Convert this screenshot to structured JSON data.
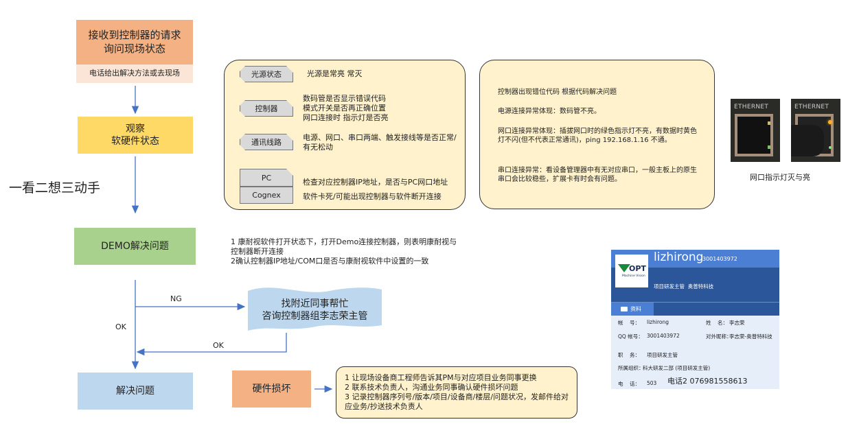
{
  "flow": {
    "step1": {
      "title": "接收到控制器的请求\n询问现场状态",
      "note": "电话给出解决方法或去现场",
      "color": "#f4b183",
      "note_color": "#fbe5d6"
    },
    "step2": {
      "title": "观察\n软硬件状态",
      "color": "#ffd966"
    },
    "motto": "一看二想三动手",
    "step3": {
      "title": "DEMO解决问题",
      "color": "#a9d18e"
    },
    "demo_notes": "1 康耐视软件打开状态下，打开Demo连接控制器，则表明康耐视与控制器断开连接\n2确认控制器IP地址/COM口是否与康耐视软件中设置的一致",
    "help": {
      "title": "找附近同事帮忙\n咨询控制器组李志荣主管",
      "color": "#bdd7ee"
    },
    "ng_label": "NG",
    "ok_label_left": "OK",
    "ok_label_return": "OK",
    "step4": {
      "title": "解决问题",
      "color": "#bdd7ee"
    },
    "hardware": {
      "title": "硬件损坏",
      "color": "#f4b183"
    },
    "hardware_steps": "1 让现场设备商工程师告诉其PM与对应项目业务同事更换\n2 联系技术负责人，沟通业务同事确认硬件损坏问题\n3 记录控制器序列号/版本/项目/设备商/楼层/问题状况，发邮件给对应业务/抄送技术负责人"
  },
  "check_panel": {
    "rows": [
      {
        "tag": "光源状态",
        "text": "光源是常亮 常灭"
      },
      {
        "tag": "控制器",
        "text": "数码管是否显示错误代码\n模式开关是否再正确位置\n网口连接时 指示灯是否亮"
      },
      {
        "tag": "通讯线路",
        "text": "电源、网口、串口两端、触发接线等是否正常/有无松动"
      },
      {
        "tag": "PC",
        "text": "检查对应控制器IP地址，是否与PC网口地址"
      },
      {
        "tag": "Cognex",
        "text": "软件卡死/可能出现控制器与软件断开连接"
      }
    ]
  },
  "diag_panel": {
    "paragraphs": [
      "控制器出现错位代码 根据代码解决问题",
      "电源连接异常体现：数码管不亮。",
      "网口连接异常体现：插拔网口时的绿色指示灯不亮，有数据时黄色灯不闪(但不代表正常通讯)，ping 192.168.1.16 不通。",
      "串口连接异常：看设备管理器中有无对应串口，一般主板上的原生串口会比较稳些，扩展卡有时会有问题。"
    ]
  },
  "ethernet_photos": {
    "label_left": "ETHERNET",
    "label_right": "ETHERNET",
    "caption": "网口指示灯灭与亮"
  },
  "contact_card": {
    "logo": "OPT",
    "logo_sub": "Machine Vision",
    "name": "lizhirong",
    "qq_header": "3001403972",
    "subtitle": "项目研发主管  奥普特科技",
    "tab": "资料",
    "fields": {
      "account_label": "帐    号：",
      "account": "lizhirong",
      "realname_label": "姓    名：",
      "realname": "李志荣",
      "qq_label": "QQ 帐号：",
      "qq": "3001403972",
      "nick_label": "对外昵称：",
      "nick": "李志荣-奥普特科技",
      "title_label": "职    务：",
      "title": "项目研发主管",
      "org_label": "所属组织：",
      "org": "科大研发二部 (项目研发主管)",
      "phone_label": "电    话：",
      "phone": "503",
      "phone2": "电话2 076981558613"
    },
    "colors": {
      "header_top": "#4a7fd4",
      "header_bottom": "#2b579a",
      "body": "#e6eefa"
    }
  },
  "colors": {
    "arrow": "#4472c4",
    "panel_bg": "#fff2cc"
  }
}
